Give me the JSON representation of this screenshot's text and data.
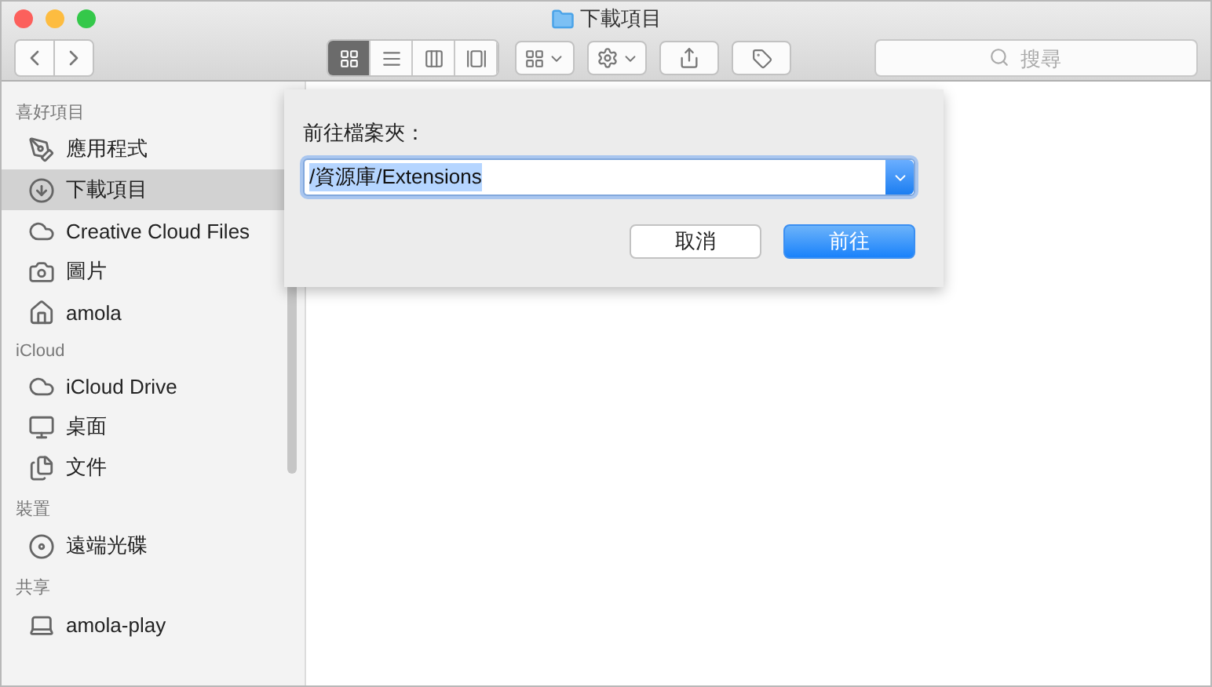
{
  "window": {
    "title": "下載項目"
  },
  "toolbar": {
    "view_modes": [
      {
        "selected": true
      },
      {
        "selected": false
      },
      {
        "selected": false
      },
      {
        "selected": false
      }
    ],
    "search": {
      "placeholder": "搜尋"
    }
  },
  "sidebar": {
    "sections": [
      {
        "heading": "喜好項目",
        "items": [
          {
            "label": "應用程式",
            "selected": false
          },
          {
            "label": "下載項目",
            "selected": true
          },
          {
            "label": "Creative Cloud Files",
            "selected": false
          },
          {
            "label": "圖片",
            "selected": false
          },
          {
            "label": "amola",
            "selected": false
          }
        ]
      },
      {
        "heading": "iCloud",
        "items": [
          {
            "label": "iCloud Drive",
            "selected": false
          },
          {
            "label": "桌面",
            "selected": false
          },
          {
            "label": "文件",
            "selected": false
          }
        ]
      },
      {
        "heading": "裝置",
        "items": [
          {
            "label": "遠端光碟",
            "selected": false
          }
        ]
      },
      {
        "heading": "共享",
        "items": [
          {
            "label": "amola-play",
            "selected": false
          }
        ]
      }
    ]
  },
  "dialog": {
    "label": "前往檔案夾：",
    "path": "/資源庫/Extensions",
    "buttons": [
      {
        "label": "取消",
        "default": false
      },
      {
        "label": "前往",
        "default": true
      }
    ]
  }
}
